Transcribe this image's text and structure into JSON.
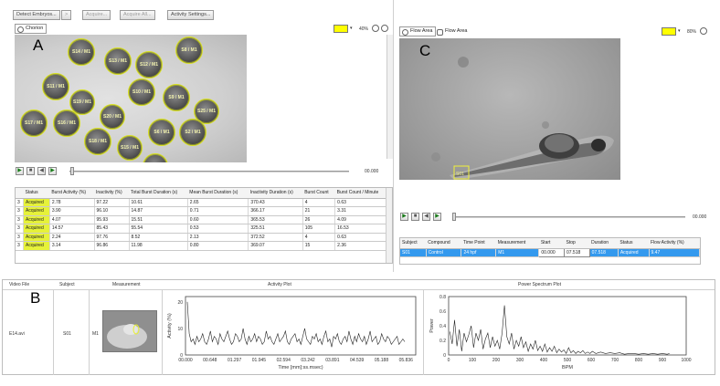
{
  "toolbar": {
    "detect_embryos": "Detect Embryos...",
    "arrow": ">",
    "acquire": "Acquire...",
    "acquire_all": "Acquire All...",
    "activity_settings": "Activity Settings..."
  },
  "panel_a": {
    "letter": "A",
    "tab_chorion": "Chorion",
    "zoom_level": "40%",
    "time": "00.000",
    "embryos": [
      "S14 / M1",
      "S13 / M1",
      "S12 / M1",
      "S8 / M1",
      "S11 / M1",
      "S10 / M1",
      "S9 / M1",
      "S19 / M1",
      "S20 / M1",
      "S25 / M1",
      "S17 / M1",
      "S16 / M1",
      "S18 / M1",
      "S6 / M1",
      "S2 / M1",
      "S15 / M1",
      "S4 / M1"
    ],
    "table": {
      "headers": [
        "",
        "Status",
        "Burst Activity (%)",
        "Inactivity (%)",
        "Total Burst Duration (s)",
        "Mean Burst Duration (s)",
        "Inactivity Duration (s)",
        "Burst Count",
        "Burst Count / Minute"
      ],
      "rows": [
        [
          "3",
          "Acquired",
          "2.78",
          "97.22",
          "10.61",
          "2.65",
          "370.43",
          "4",
          "0.63"
        ],
        [
          "3",
          "Acquired",
          "3.90",
          "96.10",
          "14.87",
          "0.71",
          "366.17",
          "21",
          "3.31"
        ],
        [
          "3",
          "Acquired",
          "4.07",
          "95.93",
          "15.51",
          "0.60",
          "365.53",
          "26",
          "4.09"
        ],
        [
          "3",
          "Acquired",
          "14.57",
          "85.43",
          "55.54",
          "0.53",
          "325.51",
          "105",
          "16.53"
        ],
        [
          "3",
          "Acquired",
          "2.24",
          "97.76",
          "8.52",
          "2.13",
          "372.52",
          "4",
          "0.63"
        ],
        [
          "3",
          "Acquired",
          "3.14",
          "96.86",
          "11.98",
          "0.80",
          "369.07",
          "15",
          "2.36"
        ]
      ]
    }
  },
  "panel_c": {
    "letter": "C",
    "tab_flow_area_1": "Flow Area",
    "tab_flow_area_2": "Flow Area",
    "zoom_level": "80%",
    "time": "00.000",
    "marker_label": "S01",
    "table": {
      "headers": [
        "Subject",
        "Compound",
        "Time Point",
        "Measurement",
        "Start",
        "Stop",
        "Duration",
        "Status",
        "Flow Activity (%)"
      ],
      "row": [
        "S01",
        "Control",
        "24 hpf",
        "M1",
        "00.000",
        "07.518",
        "07.518",
        "Acquired",
        "9.47"
      ]
    }
  },
  "panel_b": {
    "letter": "B",
    "headers": {
      "video_file": "Video File",
      "subject": "Subject",
      "measurement": "Measurement",
      "activity_plot": "Activity Plot",
      "power_plot": "Power Spectrum Plot"
    },
    "row": {
      "video_file": "E14.avi",
      "subject": "S01",
      "measurement": "M1"
    }
  },
  "chart_data": [
    {
      "type": "line",
      "title": "Activity Plot",
      "xlabel": "Time [mm]:ss.msec)",
      "ylabel": "Activity (%)",
      "x_ticks": [
        "00.000",
        "00.648",
        "01.297",
        "01.945",
        "02.594",
        "03.242",
        "03.891",
        "04.539",
        "05.188",
        "05.836"
      ],
      "y_ticks": [
        "0",
        "10",
        "20"
      ],
      "ylim": [
        0,
        22
      ],
      "values": [
        20,
        8,
        5,
        6,
        4,
        7,
        5,
        6,
        8,
        5,
        4,
        6,
        9,
        5,
        7,
        6,
        4,
        8,
        6,
        5,
        7,
        9,
        6,
        4,
        5,
        8,
        7,
        5,
        6,
        10,
        6,
        4,
        7,
        5,
        6,
        8,
        5,
        7,
        6,
        4,
        5,
        9,
        6,
        7,
        5,
        4,
        6,
        8,
        5,
        6,
        7,
        9,
        5,
        4,
        6,
        7,
        8,
        5,
        6,
        4,
        7,
        10,
        6,
        5,
        4,
        7,
        6,
        8,
        5,
        6,
        4,
        7,
        9,
        5,
        6,
        3,
        7,
        6,
        8,
        5,
        4,
        6,
        7,
        5,
        9,
        6,
        4,
        7,
        5,
        8,
        6,
        5,
        7,
        4,
        6,
        9,
        5,
        6,
        7,
        4,
        5,
        8,
        6,
        5,
        7,
        6,
        4,
        5,
        6,
        7,
        4,
        5,
        6,
        5
      ]
    },
    {
      "type": "line",
      "title": "Power Spectrum Plot",
      "xlabel": "BPM",
      "ylabel": "Power",
      "x_ticks": [
        "0",
        "100",
        "200",
        "300",
        "400",
        "500",
        "600",
        "700",
        "800",
        "900",
        "1000"
      ],
      "y_ticks": [
        "0",
        "0.2",
        "0.4",
        "0.6",
        "0.8"
      ],
      "xlim": [
        0,
        1000
      ],
      "ylim": [
        0,
        0.8
      ],
      "values": [
        [
          5,
          0.32
        ],
        [
          15,
          0.15
        ],
        [
          25,
          0.48
        ],
        [
          35,
          0.12
        ],
        [
          45,
          0.35
        ],
        [
          55,
          0.05
        ],
        [
          65,
          0.3
        ],
        [
          75,
          0.18
        ],
        [
          85,
          0.28
        ],
        [
          95,
          0.4
        ],
        [
          105,
          0.1
        ],
        [
          115,
          0.3
        ],
        [
          125,
          0.2
        ],
        [
          135,
          0.35
        ],
        [
          145,
          0.08
        ],
        [
          155,
          0.22
        ],
        [
          165,
          0.3
        ],
        [
          175,
          0.1
        ],
        [
          185,
          0.25
        ],
        [
          195,
          0.12
        ],
        [
          205,
          0.2
        ],
        [
          215,
          0.08
        ],
        [
          225,
          0.3
        ],
        [
          235,
          0.68
        ],
        [
          245,
          0.25
        ],
        [
          255,
          0.15
        ],
        [
          265,
          0.3
        ],
        [
          275,
          0.08
        ],
        [
          285,
          0.2
        ],
        [
          295,
          0.12
        ],
        [
          305,
          0.25
        ],
        [
          315,
          0.1
        ],
        [
          325,
          0.18
        ],
        [
          335,
          0.05
        ],
        [
          345,
          0.15
        ],
        [
          355,
          0.08
        ],
        [
          365,
          0.2
        ],
        [
          375,
          0.06
        ],
        [
          385,
          0.12
        ],
        [
          395,
          0.05
        ],
        [
          405,
          0.15
        ],
        [
          415,
          0.04
        ],
        [
          425,
          0.1
        ],
        [
          435,
          0.05
        ],
        [
          445,
          0.12
        ],
        [
          455,
          0.03
        ],
        [
          465,
          0.08
        ],
        [
          475,
          0.04
        ],
        [
          485,
          0.07
        ],
        [
          495,
          0.02
        ],
        [
          505,
          0.1
        ],
        [
          515,
          0.03
        ],
        [
          525,
          0.06
        ],
        [
          535,
          0.02
        ],
        [
          545,
          0.05
        ],
        [
          555,
          0.03
        ],
        [
          565,
          0.06
        ],
        [
          575,
          0.02
        ],
        [
          585,
          0.04
        ],
        [
          595,
          0.02
        ],
        [
          605,
          0.05
        ],
        [
          620,
          0.02
        ],
        [
          640,
          0.04
        ],
        [
          660,
          0.02
        ],
        [
          680,
          0.03
        ],
        [
          700,
          0.02
        ],
        [
          720,
          0.03
        ],
        [
          740,
          0.01
        ],
        [
          760,
          0.02
        ],
        [
          780,
          0.02
        ],
        [
          800,
          0.01
        ],
        [
          820,
          0.02
        ],
        [
          840,
          0.01
        ],
        [
          860,
          0.02
        ],
        [
          880,
          0.01
        ],
        [
          900,
          0.02
        ],
        [
          920,
          0.01
        ],
        [
          930,
          0.02
        ]
      ]
    }
  ]
}
